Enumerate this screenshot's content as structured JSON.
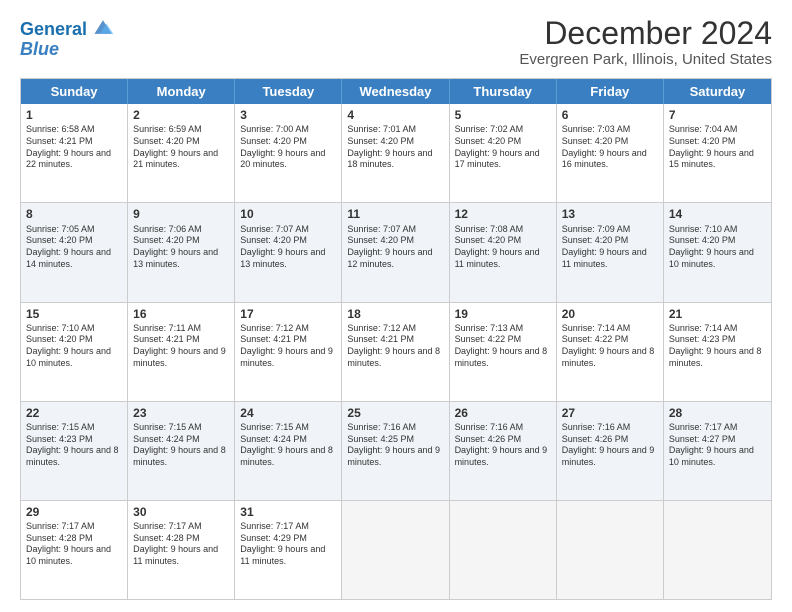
{
  "header": {
    "logo_line1": "General",
    "logo_line2": "Blue",
    "title": "December 2024",
    "subtitle": "Evergreen Park, Illinois, United States"
  },
  "days": [
    "Sunday",
    "Monday",
    "Tuesday",
    "Wednesday",
    "Thursday",
    "Friday",
    "Saturday"
  ],
  "weeks": [
    [
      {
        "day": "1",
        "text": "Sunrise: 6:58 AM\nSunset: 4:21 PM\nDaylight: 9 hours and 22 minutes."
      },
      {
        "day": "2",
        "text": "Sunrise: 6:59 AM\nSunset: 4:20 PM\nDaylight: 9 hours and 21 minutes."
      },
      {
        "day": "3",
        "text": "Sunrise: 7:00 AM\nSunset: 4:20 PM\nDaylight: 9 hours and 20 minutes."
      },
      {
        "day": "4",
        "text": "Sunrise: 7:01 AM\nSunset: 4:20 PM\nDaylight: 9 hours and 18 minutes."
      },
      {
        "day": "5",
        "text": "Sunrise: 7:02 AM\nSunset: 4:20 PM\nDaylight: 9 hours and 17 minutes."
      },
      {
        "day": "6",
        "text": "Sunrise: 7:03 AM\nSunset: 4:20 PM\nDaylight: 9 hours and 16 minutes."
      },
      {
        "day": "7",
        "text": "Sunrise: 7:04 AM\nSunset: 4:20 PM\nDaylight: 9 hours and 15 minutes."
      }
    ],
    [
      {
        "day": "8",
        "text": "Sunrise: 7:05 AM\nSunset: 4:20 PM\nDaylight: 9 hours and 14 minutes."
      },
      {
        "day": "9",
        "text": "Sunrise: 7:06 AM\nSunset: 4:20 PM\nDaylight: 9 hours and 13 minutes."
      },
      {
        "day": "10",
        "text": "Sunrise: 7:07 AM\nSunset: 4:20 PM\nDaylight: 9 hours and 13 minutes."
      },
      {
        "day": "11",
        "text": "Sunrise: 7:07 AM\nSunset: 4:20 PM\nDaylight: 9 hours and 12 minutes."
      },
      {
        "day": "12",
        "text": "Sunrise: 7:08 AM\nSunset: 4:20 PM\nDaylight: 9 hours and 11 minutes."
      },
      {
        "day": "13",
        "text": "Sunrise: 7:09 AM\nSunset: 4:20 PM\nDaylight: 9 hours and 11 minutes."
      },
      {
        "day": "14",
        "text": "Sunrise: 7:10 AM\nSunset: 4:20 PM\nDaylight: 9 hours and 10 minutes."
      }
    ],
    [
      {
        "day": "15",
        "text": "Sunrise: 7:10 AM\nSunset: 4:20 PM\nDaylight: 9 hours and 10 minutes."
      },
      {
        "day": "16",
        "text": "Sunrise: 7:11 AM\nSunset: 4:21 PM\nDaylight: 9 hours and 9 minutes."
      },
      {
        "day": "17",
        "text": "Sunrise: 7:12 AM\nSunset: 4:21 PM\nDaylight: 9 hours and 9 minutes."
      },
      {
        "day": "18",
        "text": "Sunrise: 7:12 AM\nSunset: 4:21 PM\nDaylight: 9 hours and 8 minutes."
      },
      {
        "day": "19",
        "text": "Sunrise: 7:13 AM\nSunset: 4:22 PM\nDaylight: 9 hours and 8 minutes."
      },
      {
        "day": "20",
        "text": "Sunrise: 7:14 AM\nSunset: 4:22 PM\nDaylight: 9 hours and 8 minutes."
      },
      {
        "day": "21",
        "text": "Sunrise: 7:14 AM\nSunset: 4:23 PM\nDaylight: 9 hours and 8 minutes."
      }
    ],
    [
      {
        "day": "22",
        "text": "Sunrise: 7:15 AM\nSunset: 4:23 PM\nDaylight: 9 hours and 8 minutes."
      },
      {
        "day": "23",
        "text": "Sunrise: 7:15 AM\nSunset: 4:24 PM\nDaylight: 9 hours and 8 minutes."
      },
      {
        "day": "24",
        "text": "Sunrise: 7:15 AM\nSunset: 4:24 PM\nDaylight: 9 hours and 8 minutes."
      },
      {
        "day": "25",
        "text": "Sunrise: 7:16 AM\nSunset: 4:25 PM\nDaylight: 9 hours and 9 minutes."
      },
      {
        "day": "26",
        "text": "Sunrise: 7:16 AM\nSunset: 4:26 PM\nDaylight: 9 hours and 9 minutes."
      },
      {
        "day": "27",
        "text": "Sunrise: 7:16 AM\nSunset: 4:26 PM\nDaylight: 9 hours and 9 minutes."
      },
      {
        "day": "28",
        "text": "Sunrise: 7:17 AM\nSunset: 4:27 PM\nDaylight: 9 hours and 10 minutes."
      }
    ],
    [
      {
        "day": "29",
        "text": "Sunrise: 7:17 AM\nSunset: 4:28 PM\nDaylight: 9 hours and 10 minutes."
      },
      {
        "day": "30",
        "text": "Sunrise: 7:17 AM\nSunset: 4:28 PM\nDaylight: 9 hours and 11 minutes."
      },
      {
        "day": "31",
        "text": "Sunrise: 7:17 AM\nSunset: 4:29 PM\nDaylight: 9 hours and 11 minutes."
      },
      {
        "day": "",
        "text": ""
      },
      {
        "day": "",
        "text": ""
      },
      {
        "day": "",
        "text": ""
      },
      {
        "day": "",
        "text": ""
      }
    ]
  ]
}
